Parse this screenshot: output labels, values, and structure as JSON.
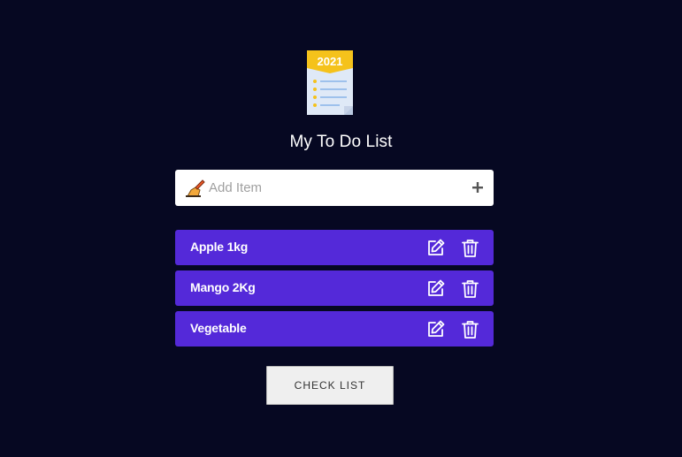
{
  "header": {
    "logo_icon": "notepad-2021-icon",
    "logo_year": "2021",
    "title": "My To Do List"
  },
  "add_item": {
    "pen_icon": "writing-hand-icon",
    "placeholder": "Add Item",
    "value": "",
    "add_icon": "plus-icon"
  },
  "items": [
    {
      "label": "Apple 1kg",
      "edit_icon": "edit-icon",
      "delete_icon": "trash-icon"
    },
    {
      "label": "Mango 2Kg",
      "edit_icon": "edit-icon",
      "delete_icon": "trash-icon"
    },
    {
      "label": "Vegetable",
      "edit_icon": "edit-icon",
      "delete_icon": "trash-icon"
    }
  ],
  "footer": {
    "check_list_label": "CHECK LIST"
  },
  "colors": {
    "background": "#060822",
    "item_background": "#5429d9",
    "input_background": "#ffffff",
    "button_background": "#efefef"
  }
}
